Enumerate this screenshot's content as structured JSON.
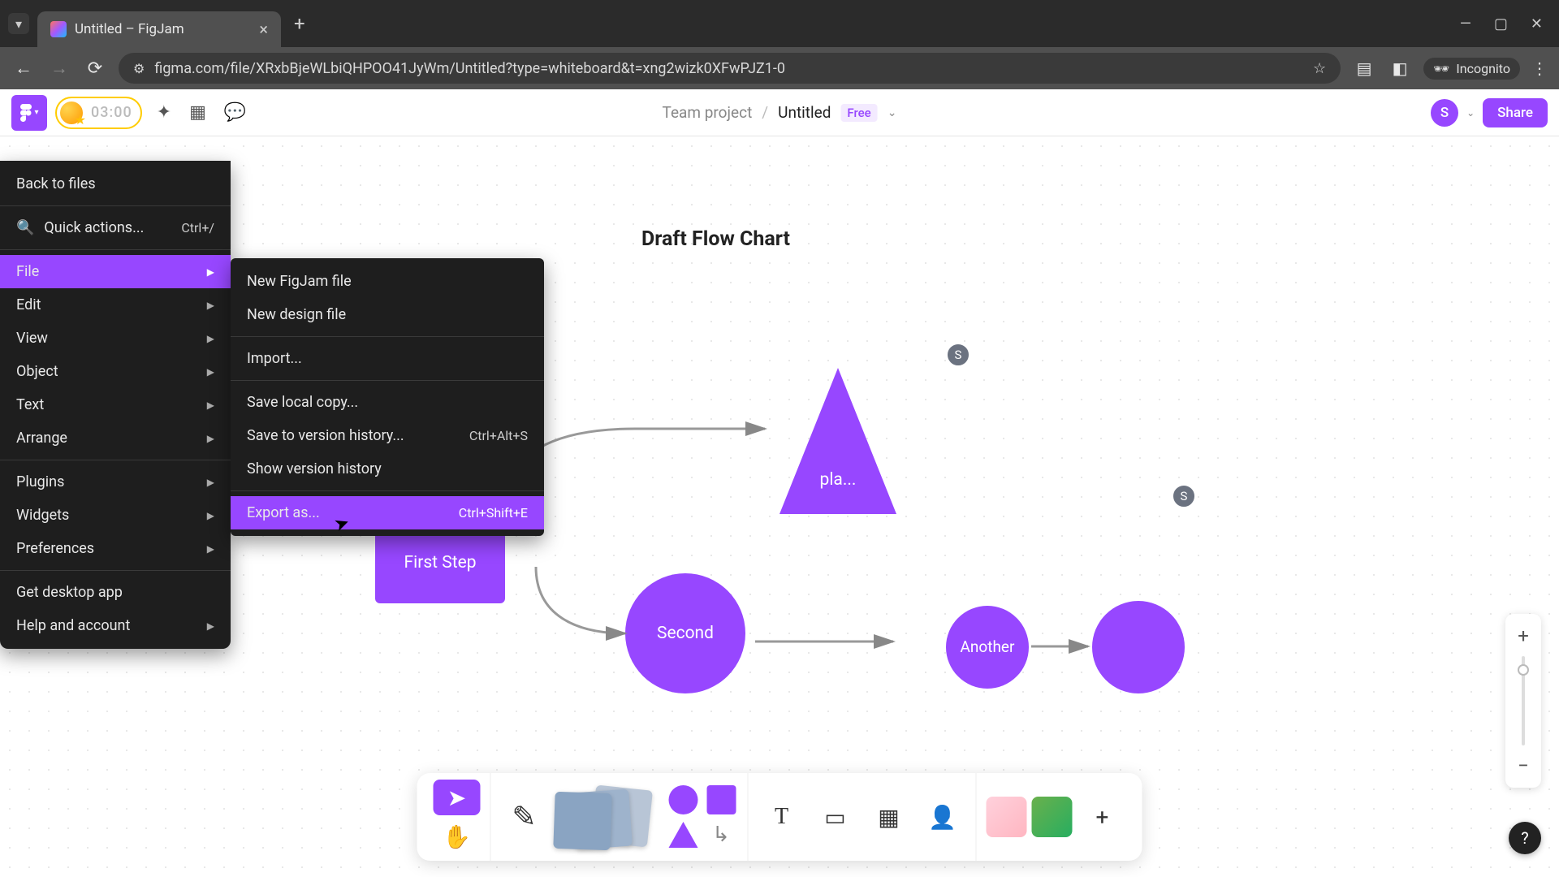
{
  "browser": {
    "tab_title": "Untitled – FigJam",
    "url": "figma.com/file/XRxbBjeWLbiQHPOO41JyWm/Untitled?type=whiteboard&t=xng2wizk0XFwPJZ1-0",
    "incognito_label": "Incognito"
  },
  "header": {
    "timer": "03:00",
    "team": "Team project",
    "title": "Untitled",
    "plan_badge": "Free",
    "user_initial": "S",
    "share": "Share"
  },
  "main_menu": {
    "back": "Back to files",
    "quick_actions": "Quick actions...",
    "quick_shortcut": "Ctrl+/",
    "items": {
      "file": "File",
      "edit": "Edit",
      "view": "View",
      "object": "Object",
      "text": "Text",
      "arrange": "Arrange",
      "plugins": "Plugins",
      "widgets": "Widgets",
      "preferences": "Preferences",
      "desktop": "Get desktop app",
      "help": "Help and account"
    }
  },
  "file_submenu": {
    "new_figjam": "New FigJam file",
    "new_design": "New design file",
    "import": "Import...",
    "save_local": "Save local copy...",
    "save_version": "Save to version history...",
    "save_version_shortcut": "Ctrl+Alt+S",
    "show_history": "Show version history",
    "export_as": "Export as...",
    "export_shortcut": "Ctrl+Shift+E"
  },
  "canvas": {
    "title": "Draft Flow Chart",
    "first_step": "First Step",
    "triangle_label": "pla...",
    "second": "Second",
    "another": "Another",
    "cursor_s1": "S",
    "cursor_s2": "S"
  },
  "help": "?"
}
